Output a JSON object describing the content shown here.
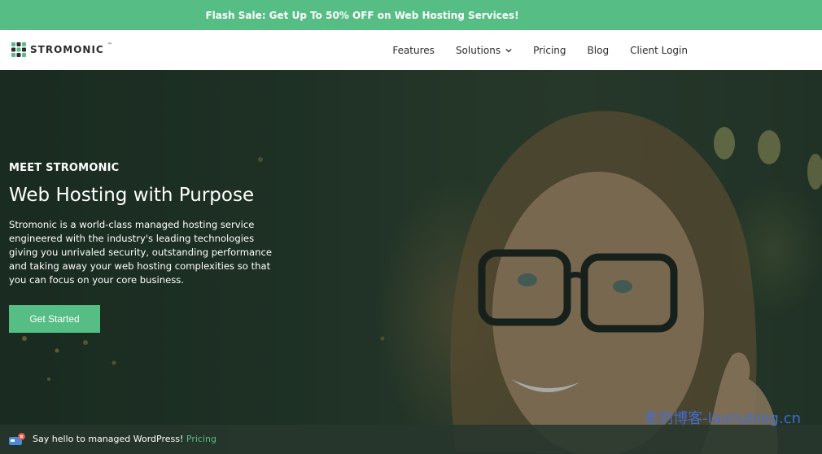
{
  "flash": {
    "text": "Flash Sale: Get Up To 50% OFF on Web Hosting Services!"
  },
  "brand": {
    "name": "STROMONIC",
    "tm": "™",
    "accent": "#56be85"
  },
  "nav": {
    "items": [
      {
        "label": "Features"
      },
      {
        "label": "Solutions"
      },
      {
        "label": "Pricing"
      },
      {
        "label": "Blog"
      },
      {
        "label": "Client Login"
      }
    ]
  },
  "hero": {
    "kicker": "MEET STROMONIC",
    "title": "Web Hosting with Purpose",
    "description": "Stromonic is a world-class managed hosting service engineered with the industry's leading technologies giving you unrivaled security, outstanding performance and taking away your web hosting complexities so that you can focus on your core business.",
    "cta": "Get Started"
  },
  "notice": {
    "icon": "wordpress-promo-icon",
    "text": "Say hello to managed WordPress! ",
    "link": "Pricing"
  },
  "watermark": {
    "text": "老刘博客-laoliublog.cn"
  }
}
